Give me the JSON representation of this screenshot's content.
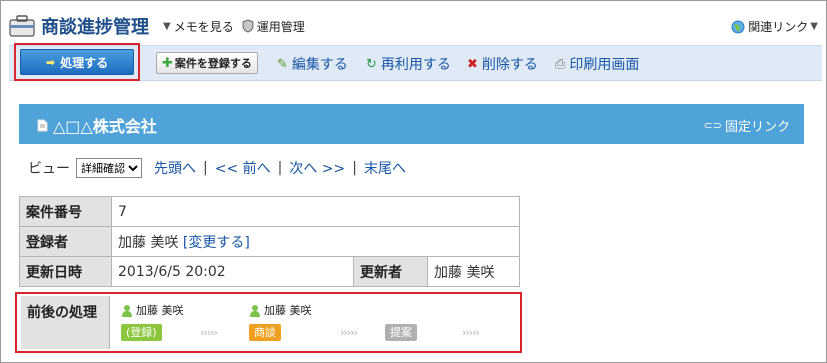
{
  "app": {
    "title": "商談進捗管理",
    "memo_label": "メモを見る",
    "admin_label": "運用管理",
    "related_label": "関連リンク"
  },
  "toolbar": {
    "process_label": "処理する",
    "register_label": "案件を登録する",
    "edit_label": "編集する",
    "reuse_label": "再利用する",
    "delete_label": "削除する",
    "print_label": "印刷用画面"
  },
  "record": {
    "title": "△□△株式会社",
    "fixed_link_label": "固定リンク"
  },
  "view": {
    "label": "ビュー",
    "selected": "詳細確認",
    "first": "先頭へ",
    "prev": "<< 前へ",
    "next": "次へ >>",
    "last": "末尾へ",
    "separator": "|"
  },
  "fields": {
    "case_no_label": "案件番号",
    "case_no": "7",
    "registrant_label": "登録者",
    "registrant": "加藤 美咲",
    "change_label": "[変更する]",
    "updated_label": "更新日時",
    "updated": "2013/6/5 20:02",
    "updater_label": "更新者",
    "updater": "加藤 美咲"
  },
  "flow": {
    "label": "前後の処理",
    "steps": [
      {
        "user": "加藤 美咲",
        "status": "(登録)",
        "color": "#8cc63f"
      },
      {
        "user": "加藤 美咲",
        "status": "商談",
        "color": "#f0a020"
      },
      {
        "user": "",
        "status": "提案",
        "color": "#b0b0b0"
      }
    ],
    "arrow_glyphs": "›››››"
  }
}
